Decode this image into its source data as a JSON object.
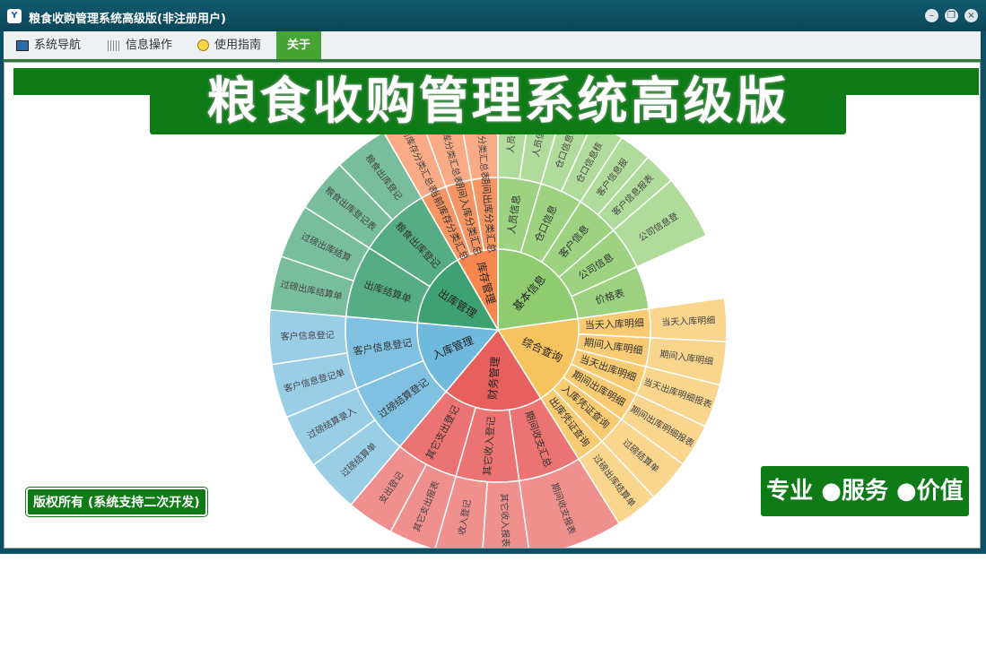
{
  "window": {
    "title": "粮食收购管理系统高级版(非注册用户)",
    "app_icon": "Y"
  },
  "titlebar_buttons": {
    "minimize": "–",
    "restore": "❐",
    "close": "×"
  },
  "menu": [
    {
      "label": "系统导航",
      "icon": "monitor-icon"
    },
    {
      "label": "信息操作",
      "icon": "grid-icon"
    },
    {
      "label": "使用指南",
      "icon": "bulb-icon"
    },
    {
      "label": "关于",
      "icon": ""
    }
  ],
  "banner": "粮食收购管理系统高级版",
  "copyright": "版权所有 (系统支持二次开发)",
  "slogan": "专业 ●服务 ●价值",
  "colors": {
    "green": "#0e7b17",
    "menu_active": "#46a433",
    "titlebar": "#0b4658"
  },
  "sunburst": {
    "sectors": [
      {
        "label": "基本信息",
        "color": "#8fcc6f",
        "items": [
          {
            "label": "人员信息",
            "leaves": [
              "人员信",
              "人员信"
            ]
          },
          {
            "label": "仓口信息",
            "leaves": [
              "仓口信息",
              "仓口信息核"
            ]
          },
          {
            "label": "客户信息",
            "leaves": [
              "客户信息报",
              "客户信息报表"
            ]
          },
          {
            "label": "公司信息",
            "leaves": [
              "公司信息登"
            ]
          },
          {
            "label": "价格表",
            "leaves": []
          }
        ]
      },
      {
        "label": "综合查询",
        "color": "#f7c35e",
        "items": [
          {
            "label": "当天入库明细",
            "leaves": [
              "当天入库明细"
            ]
          },
          {
            "label": "期间入库明细",
            "leaves": [
              "期间入库明细"
            ]
          },
          {
            "label": "当天出库明细",
            "leaves": [
              "当天出库明细报表"
            ]
          },
          {
            "label": "期间出库明细",
            "leaves": [
              "期间出库明细报表"
            ]
          },
          {
            "label": "入库凭证查询",
            "leaves": [
              "过磅结算单"
            ]
          },
          {
            "label": "出库凭证查询",
            "leaves": [
              "过磅出库结算单"
            ]
          }
        ]
      },
      {
        "label": "财务管理",
        "color": "#e8605e",
        "items": [
          {
            "label": "期间收支汇总",
            "leaves": [
              "期间收支报表"
            ]
          },
          {
            "label": "其它收入登记",
            "leaves": [
              "其它收入报表",
              "收入登记"
            ]
          },
          {
            "label": "其它支出登记",
            "leaves": [
              "其它支出报表",
              "支出登记"
            ]
          }
        ]
      },
      {
        "label": "入库管理",
        "color": "#6fb9dd",
        "items": [
          {
            "label": "过磅结算登记",
            "leaves": [
              "过磅结算单",
              "过磅结算录入"
            ]
          },
          {
            "label": "客户信息登记",
            "leaves": [
              "客户信息登记单",
              "客户信息登记"
            ]
          }
        ]
      },
      {
        "label": "出库管理",
        "color": "#3ea174",
        "items": [
          {
            "label": "出库结算单",
            "leaves": [
              "过磅出库结算单",
              "过磅出库结算"
            ]
          },
          {
            "label": "粮食出库登记",
            "leaves": [
              "粮食出库登记表",
              "粮食出库登记"
            ]
          }
        ]
      },
      {
        "label": "库存管理",
        "color": "#f5874f",
        "items": [
          {
            "label": "当前库存分类汇总",
            "leaves": [
              "当前库存分类汇总表"
            ]
          },
          {
            "label": "期间入库分类汇总",
            "leaves": [
              "期间入库分类汇总表"
            ]
          },
          {
            "label": "期间出库分类汇总",
            "leaves": [
              "期间出库分类汇总表"
            ]
          }
        ]
      }
    ]
  }
}
